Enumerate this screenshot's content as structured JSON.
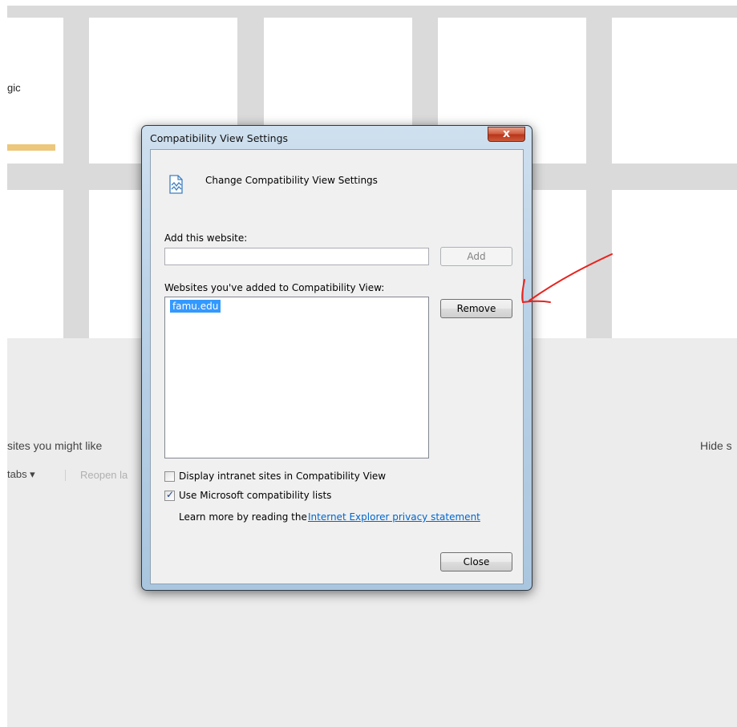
{
  "background": {
    "tile_text": "gic",
    "section_label": "sites you might like",
    "hide_link": "Hide s",
    "tabs_label": "tabs ▾",
    "reopen_label": "Reopen la"
  },
  "dialog": {
    "title": "Compatibility View Settings",
    "close_glyph": "x",
    "header_text": "Change Compatibility View Settings",
    "add_label": "Add this website:",
    "add_input_value": "",
    "add_button": "Add",
    "list_label": "Websites you've added to Compatibility View:",
    "websites": [
      "famu.edu"
    ],
    "remove_button": "Remove",
    "checkbox_intranet": {
      "label": "Display intranet sites in Compatibility View",
      "checked": false
    },
    "checkbox_ms_lists": {
      "label": "Use Microsoft compatibility lists",
      "checked": true
    },
    "learn_more_text": "Learn more by reading the",
    "privacy_link": "Internet Explorer privacy statement",
    "close_button": "Close"
  },
  "colors": {
    "selection": "#3399ff",
    "link": "#0066cc",
    "annotation": "#e8231e"
  }
}
